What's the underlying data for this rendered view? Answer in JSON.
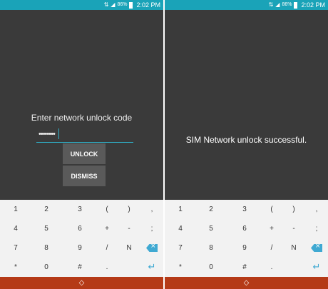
{
  "status_bar": {
    "sim_icon": "sim-icon",
    "signal_icon": "signal-icon",
    "battery_icon": "battery-icon",
    "battery_text": "86%",
    "time": "2:02 PM"
  },
  "left_screen": {
    "prompt_label": "Enter network unlock code",
    "code_value": "••••••••",
    "unlock_label": "UNLOCK",
    "dismiss_label": "DISMISS"
  },
  "right_screen": {
    "success_text": "SIM Network unlock successful."
  },
  "keyboard": {
    "keys": [
      {
        "label": "1",
        "icon": null
      },
      {
        "label": "2",
        "icon": null
      },
      {
        "label": "3",
        "icon": null
      },
      {
        "label": "(",
        "icon": null
      },
      {
        "label": ")",
        "icon": null
      },
      {
        "label": ",",
        "icon": null
      },
      {
        "label": "4",
        "icon": null
      },
      {
        "label": "5",
        "icon": null
      },
      {
        "label": "6",
        "icon": null
      },
      {
        "label": "+",
        "icon": null
      },
      {
        "label": "-",
        "icon": null
      },
      {
        "label": ";",
        "icon": null
      },
      {
        "label": "7",
        "icon": null
      },
      {
        "label": "8",
        "icon": null
      },
      {
        "label": "9",
        "icon": null
      },
      {
        "label": "/",
        "icon": null
      },
      {
        "label": "N",
        "icon": null
      },
      {
        "label": "",
        "icon": "backspace-icon"
      },
      {
        "label": "*",
        "icon": null
      },
      {
        "label": "0",
        "icon": null
      },
      {
        "label": "#",
        "icon": null
      },
      {
        "label": ".",
        "icon": null
      },
      {
        "label": "",
        "icon": null
      },
      {
        "label": "",
        "icon": "enter-icon"
      }
    ]
  },
  "nav_bar": {
    "icon": "diamond-icon"
  },
  "colors": {
    "status_bar": "#1aa3b8",
    "screen_bg": "#3a3a3a",
    "button_bg": "#5a5a5a",
    "accent": "#2fb0c8",
    "keyboard_bg": "#f2f2f2",
    "key_accent": "#3fa9d2",
    "nav_bar": "#b53a17"
  }
}
